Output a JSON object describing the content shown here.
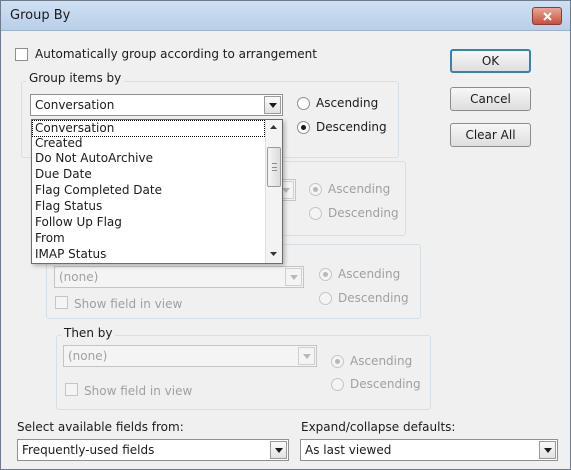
{
  "dialog": {
    "title": "Group By"
  },
  "auto_group": {
    "label": "Automatically group according to arrangement",
    "checked": false
  },
  "buttons": {
    "ok": "OK",
    "cancel": "Cancel",
    "clear_all": "Clear All"
  },
  "group_items_by": {
    "title": "Group items by",
    "value": "Conversation",
    "ascending": "Ascending",
    "descending": "Descending",
    "selected_order": "Descending"
  },
  "dropdown_list": {
    "items": [
      "Conversation",
      "Created",
      "Do Not AutoArchive",
      "Due Date",
      "Flag Completed Date",
      "Flag Status",
      "Follow Up Flag",
      "From",
      "IMAP Status"
    ],
    "highlighted": "Conversation"
  },
  "then_by_1": {
    "ascending": "Ascending",
    "descending": "Descending"
  },
  "then_by_2": {
    "value": "(none)",
    "show_field": "Show field in view",
    "ascending": "Ascending",
    "descending": "Descending"
  },
  "then_by_3": {
    "title": "Then by",
    "value": "(none)",
    "show_field": "Show field in view",
    "ascending": "Ascending",
    "descending": "Descending"
  },
  "footer": {
    "available_fields_label": "Select available fields from:",
    "available_fields_value": "Frequently-used fields",
    "expand_label": "Expand/collapse defaults:",
    "expand_value": "As last viewed"
  },
  "colors": {
    "title_bar": "#c6dbf1",
    "close_button": "#d0604c",
    "default_button_border": "#3c7fb1",
    "group_border": "#d5dfe5"
  }
}
